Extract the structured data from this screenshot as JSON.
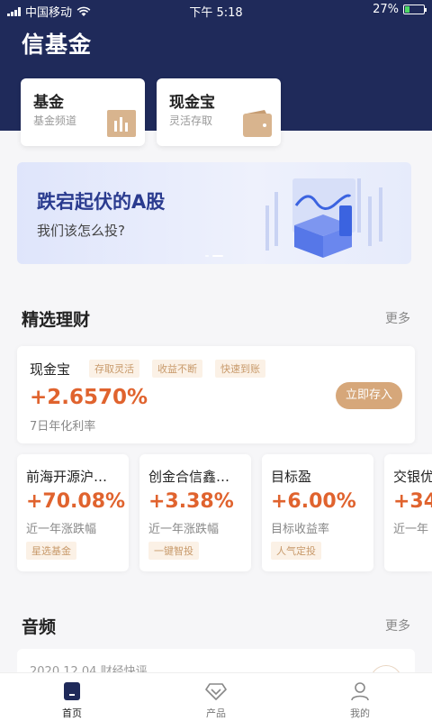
{
  "status": {
    "carrier": "中国移动",
    "time": "下午 5:18",
    "battery": "27%",
    "battery_level": 0.27
  },
  "app": {
    "title": "信基金"
  },
  "shortcuts": [
    {
      "title": "基金",
      "subtitle": "基金频道",
      "icon": "bar-chart-icon"
    },
    {
      "title": "现金宝",
      "subtitle": "灵活存取",
      "icon": "wallet-icon"
    }
  ],
  "banner": {
    "title": "跌宕起伏的A股",
    "subtitle": "我们该怎么投?"
  },
  "section_featured": {
    "title": "精选理财",
    "more": "更多"
  },
  "featured": {
    "name": "现金宝",
    "tags": [
      "存取灵活",
      "收益不断",
      "快速到账"
    ],
    "rate": "+2.6570%",
    "rate_label": "7日年化利率",
    "button": "立即存入"
  },
  "funds": [
    {
      "name": "前海开源沪…",
      "rate": "+70.08%",
      "label": "近一年涨跌幅",
      "tag": "星选基金"
    },
    {
      "name": "创金合信鑫…",
      "rate": "+3.38%",
      "label": "近一年涨跌幅",
      "tag": "一键智投"
    },
    {
      "name": "目标盈",
      "rate": "+6.00%",
      "label": "目标收益率",
      "tag": "人气定投"
    },
    {
      "name": "交银优",
      "rate": "+34",
      "label": "近一年",
      "tag": ""
    }
  ],
  "section_audio": {
    "title": "音频",
    "more": "更多"
  },
  "audio": {
    "date_category": "2020.12.04  财经快评"
  },
  "tabs": [
    {
      "label": "首页",
      "icon": "home-icon",
      "active": true
    },
    {
      "label": "产品",
      "icon": "diamond-icon",
      "active": false
    },
    {
      "label": "我的",
      "icon": "user-icon",
      "active": false
    }
  ],
  "colors": {
    "header": "#1f2a5a",
    "accent": "#e0632e",
    "gold": "#d6a77a",
    "banner_title": "#2a3b8f"
  }
}
